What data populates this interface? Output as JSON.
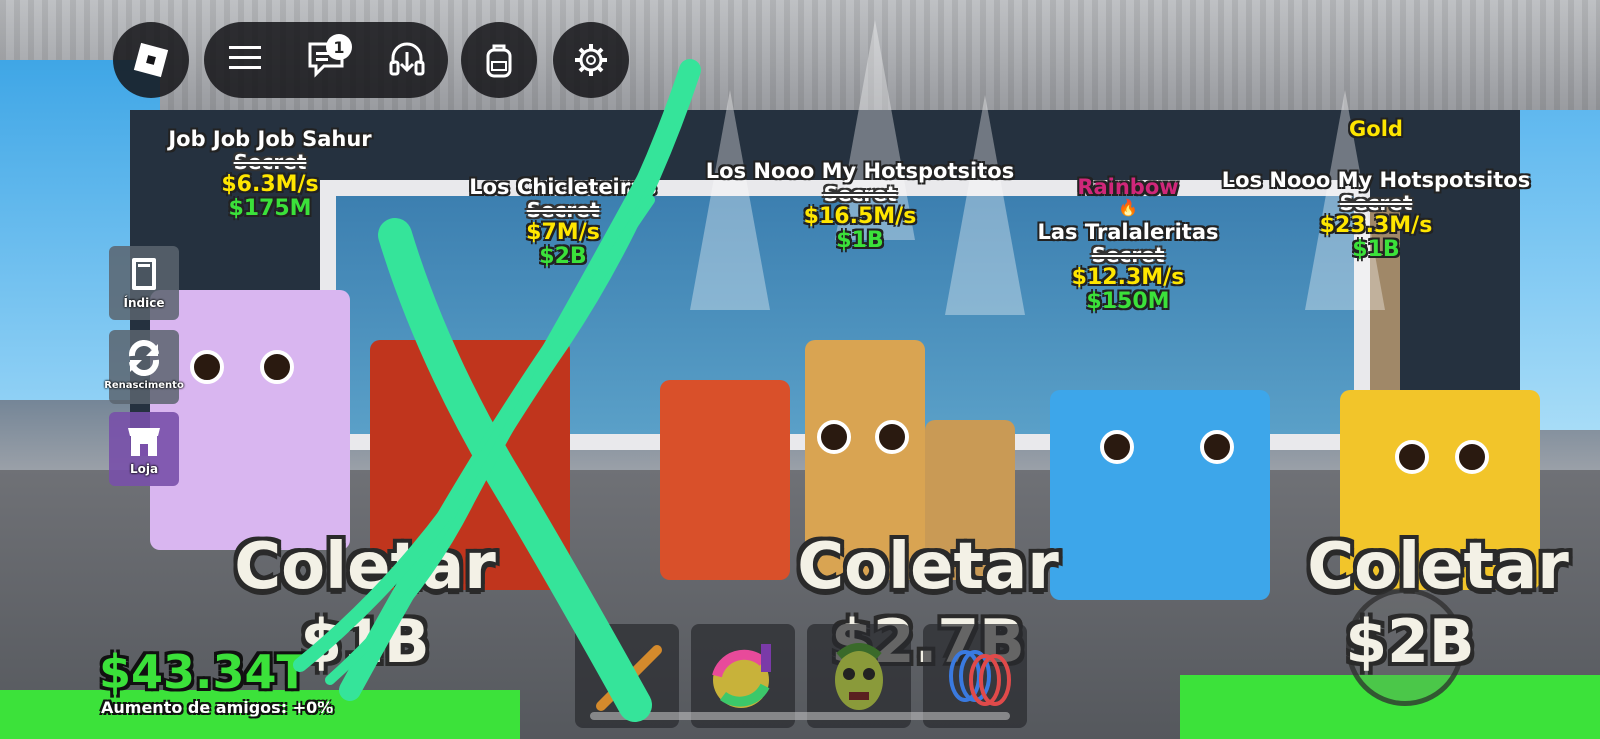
{
  "topbar": {
    "roblox_icon": "roblox-logo-icon",
    "menu_icon": "hamburger-menu-icon",
    "chat_icon": "chat-icon",
    "chat_badge": "1",
    "voice_icon": "headset-icon",
    "backpack_icon": "backpack-icon",
    "settings_icon": "gear-icon"
  },
  "sidebar": {
    "items": [
      {
        "label": "Índice",
        "icon": "book-icon"
      },
      {
        "label": "Renascimento",
        "icon": "refresh-icon"
      },
      {
        "label": "Loja",
        "icon": "shop-icon"
      }
    ]
  },
  "pets": [
    {
      "name": "Job Job Job Sahur",
      "rarity": "Secret",
      "rate": "$6.3M/s",
      "value": "$175M"
    },
    {
      "name": "Los Chicleteiras",
      "rarity": "Secret",
      "rate": "$7M/s",
      "value": "$2B"
    },
    {
      "name": "Los Nooo My Hotspotsitos",
      "rarity": "Secret",
      "rate": "$16.5M/s",
      "value": "$1B"
    },
    {
      "tag": "Rainbow",
      "name": "Las Tralaleritas",
      "rarity": "Secret",
      "rate": "$12.3M/s",
      "value": "$150M"
    },
    {
      "tag": "Gold",
      "name": "Los Nooo My Hotspotsitos",
      "rarity": "Secret",
      "rate": "$23.3M/s",
      "value": "$1B"
    }
  ],
  "collect": [
    {
      "label": "Coletar",
      "amount": "$1B"
    },
    {
      "label": "Coletar",
      "amount": "$2.7B"
    },
    {
      "label": "Coletar",
      "amount": "$2B"
    }
  ],
  "hud": {
    "money": "$43.34T",
    "friends_boost": "Aumento de amigos: +0%"
  },
  "hotbar": {
    "slots": [
      "bat-icon",
      "disco-ball-icon",
      "zombie-mask-icon",
      "spring-coil-icon"
    ]
  },
  "colors": {
    "money_green": "#3be13a",
    "rate_yellow": "#ffe600",
    "scribble": "#35e49a"
  }
}
